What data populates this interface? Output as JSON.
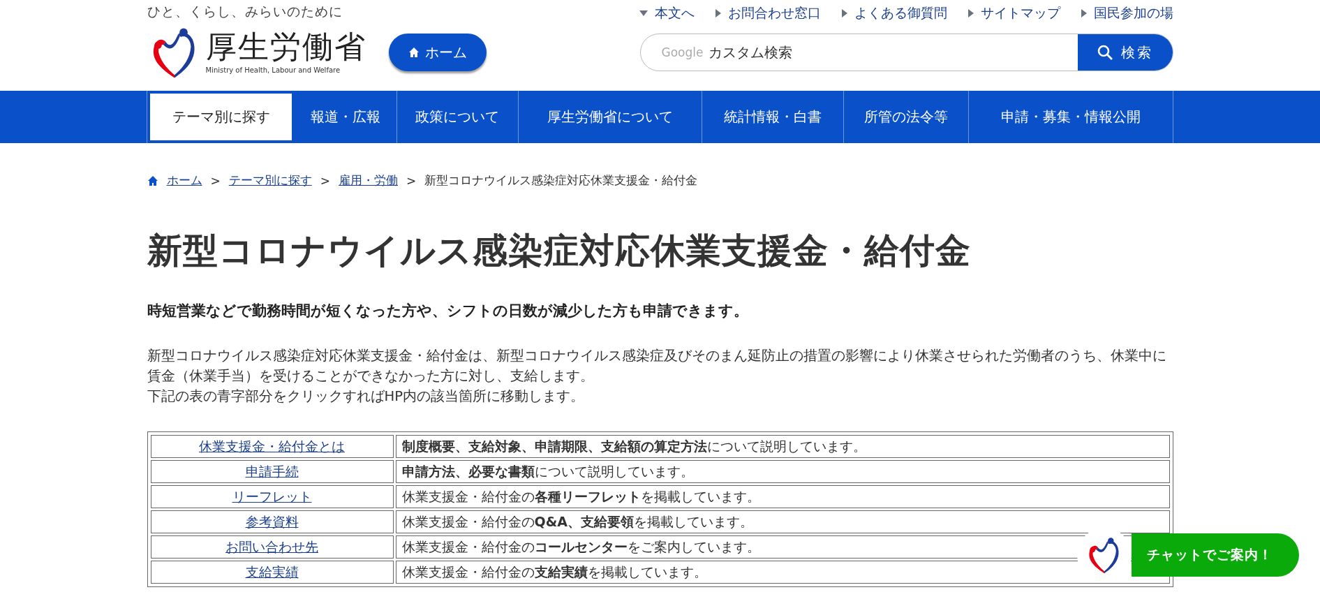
{
  "header": {
    "tagline": "ひと、くらし、みらいのために",
    "logo_title": "厚生労働省",
    "logo_subtitle": "Ministry of Health, Labour and Welfare",
    "home_button": "ホーム",
    "utility_links": [
      {
        "label": "本文へ",
        "kind": "down"
      },
      {
        "label": "お問合わせ窓口",
        "kind": "right"
      },
      {
        "label": "よくある御質問",
        "kind": "right"
      },
      {
        "label": "サイトマップ",
        "kind": "right"
      },
      {
        "label": "国民参加の場",
        "kind": "right"
      }
    ],
    "search": {
      "brand": "Google",
      "placeholder": "カスタム検索",
      "button": "検索"
    }
  },
  "nav": [
    {
      "label": "テーマ別に探す",
      "selected": true
    },
    {
      "label": "報道・広報",
      "selected": false
    },
    {
      "label": "政策について",
      "selected": false
    },
    {
      "label": "厚生労働省について",
      "selected": false
    },
    {
      "label": "統計情報・白書",
      "selected": false
    },
    {
      "label": "所管の法令等",
      "selected": false
    },
    {
      "label": "申請・募集・情報公開",
      "selected": false
    }
  ],
  "breadcrumb": {
    "links": [
      "ホーム",
      "テーマ別に探す",
      "雇用・労働"
    ],
    "separator": ">",
    "current": "新型コロナウイルス感染症対応休業支援金・給付金"
  },
  "title": "新型コロナウイルス感染症対応休業支援金・給付金",
  "lead": "時短営業などで勤務時間が短くなった方や、シフトの日数が減少した方も申請できます。",
  "paragraphs": [
    "新型コロナウイルス感染症対応休業支援金・給付金は、新型コロナウイルス感染症及びそのまん延防止の措置の影響により休業させられた労働者のうち、休業中に賃金（休業手当）を受けることができなかった方に対し、支給します。",
    "下記の表の青字部分をクリックすればHP内の該当箇所に移動します。"
  ],
  "table": {
    "rows": [
      {
        "link": "休業支援金・給付金とは",
        "description": "**制度概要、支給対象、申請期限、支給額の算定方法**について説明しています。"
      },
      {
        "link": "申請手続",
        "description": "**申請方法、必要な書類**について説明しています。"
      },
      {
        "link": "リーフレット",
        "description": "休業支援金・給付金の**各種リーフレット**を掲載しています。"
      },
      {
        "link": "参考資料",
        "description": "休業支援金・給付金の**Q&A、支給要領**を掲載しています。"
      },
      {
        "link": "お問い合わせ先",
        "description": "休業支援金・給付金の**コールセンター**をご案内しています。"
      },
      {
        "link": "支給実績",
        "description": "休業支援金・給付金の**支給実績**を掲載しています。"
      }
    ]
  },
  "chat_button": "チャットでご案内！"
}
